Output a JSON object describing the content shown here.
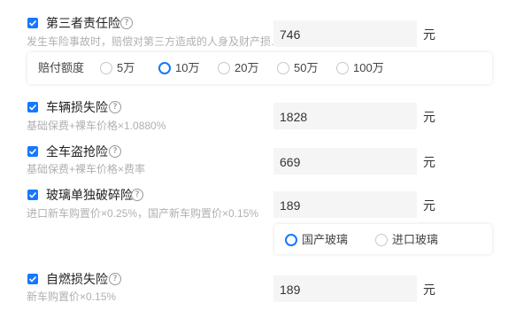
{
  "items": [
    {
      "title": "第三者责任险",
      "desc": "发生车险事故时，赔偿对第三方造成的人身及财产损...",
      "value": "746",
      "unit": "元",
      "checked": true
    },
    {
      "title": "车辆损失险",
      "desc": "基础保费+裸车价格×1.0880%",
      "value": "1828",
      "unit": "元",
      "checked": true
    },
    {
      "title": "全车盗抢险",
      "desc": "基础保费+裸车价格×费率",
      "value": "669",
      "unit": "元",
      "checked": true
    },
    {
      "title": "玻璃单独破碎险",
      "desc": "进口新车购置价×0.25%，国产新车购置价×0.15%",
      "value": "189",
      "unit": "元",
      "checked": true
    },
    {
      "title": "自燃损失险",
      "desc": "新车购置价×0.15%",
      "value": "189",
      "unit": "元",
      "checked": true
    }
  ],
  "help_symbol": "?",
  "coverage": {
    "label": "赔付额度",
    "options": [
      "5万",
      "10万",
      "20万",
      "50万",
      "100万"
    ],
    "selected": "10万"
  },
  "glass": {
    "options": [
      "国产玻璃",
      "进口玻璃"
    ],
    "selected": "国产玻璃"
  },
  "colors": {
    "accent": "#1677ff",
    "desc": "#b0b0b0",
    "field_bg": "#f5f5f5"
  }
}
